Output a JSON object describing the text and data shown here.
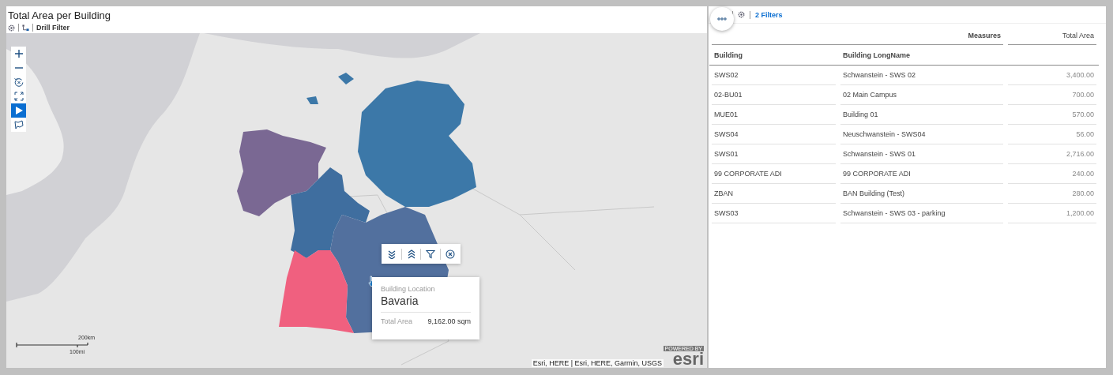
{
  "widget": {
    "title": "Total Area per Building",
    "drill_filter": "Drill Filter"
  },
  "map": {
    "tools": [
      {
        "kind": "zoom_in",
        "selected": false
      },
      {
        "kind": "zoom_out",
        "selected": false
      },
      {
        "kind": "reset",
        "selected": false
      },
      {
        "kind": "fullscreen",
        "selected": false
      },
      {
        "kind": "play",
        "selected": true
      },
      {
        "kind": "lasso",
        "selected": false
      }
    ],
    "scale_km": "200km",
    "scale_mi": "100mi",
    "attribution": "Esri, HERE | Esri, HERE, Garmin, USGS",
    "logo_caption": "POWERED BY",
    "logo": "esri"
  },
  "tooltip": {
    "dimension_label": "Building Location",
    "dimension_value": "Bavaria",
    "measure_label": "Total Area",
    "measure_value": "9,162.00 sqm"
  },
  "table": {
    "filters": "2 Filters",
    "measures_label": "Measures",
    "measure_column": "Total Area",
    "columns": [
      "Building",
      "Building LongName"
    ],
    "rows": [
      {
        "building": "SWS02",
        "long_name": "Schwanstein - SWS 02",
        "total_area": "3,400.00"
      },
      {
        "building": "02-BU01",
        "long_name": "02 Main Campus",
        "total_area": "700.00"
      },
      {
        "building": "MUE01",
        "long_name": "Building 01",
        "total_area": "570.00"
      },
      {
        "building": "SWS04",
        "long_name": "Neuschwanstein - SWS04",
        "total_area": "56.00"
      },
      {
        "building": "SWS01",
        "long_name": "Schwanstein - SWS 01",
        "total_area": "2,716.00"
      },
      {
        "building": "99 CORPORATE ADI",
        "long_name": "99 CORPORATE ADI",
        "total_area": "240.00"
      },
      {
        "building": "ZBAN",
        "long_name": "BAN Building (Test)",
        "total_area": "280.00"
      },
      {
        "building": "SWS03",
        "long_name": "Schwanstein - SWS 03 - parking",
        "total_area": "1,200.00"
      }
    ]
  }
}
